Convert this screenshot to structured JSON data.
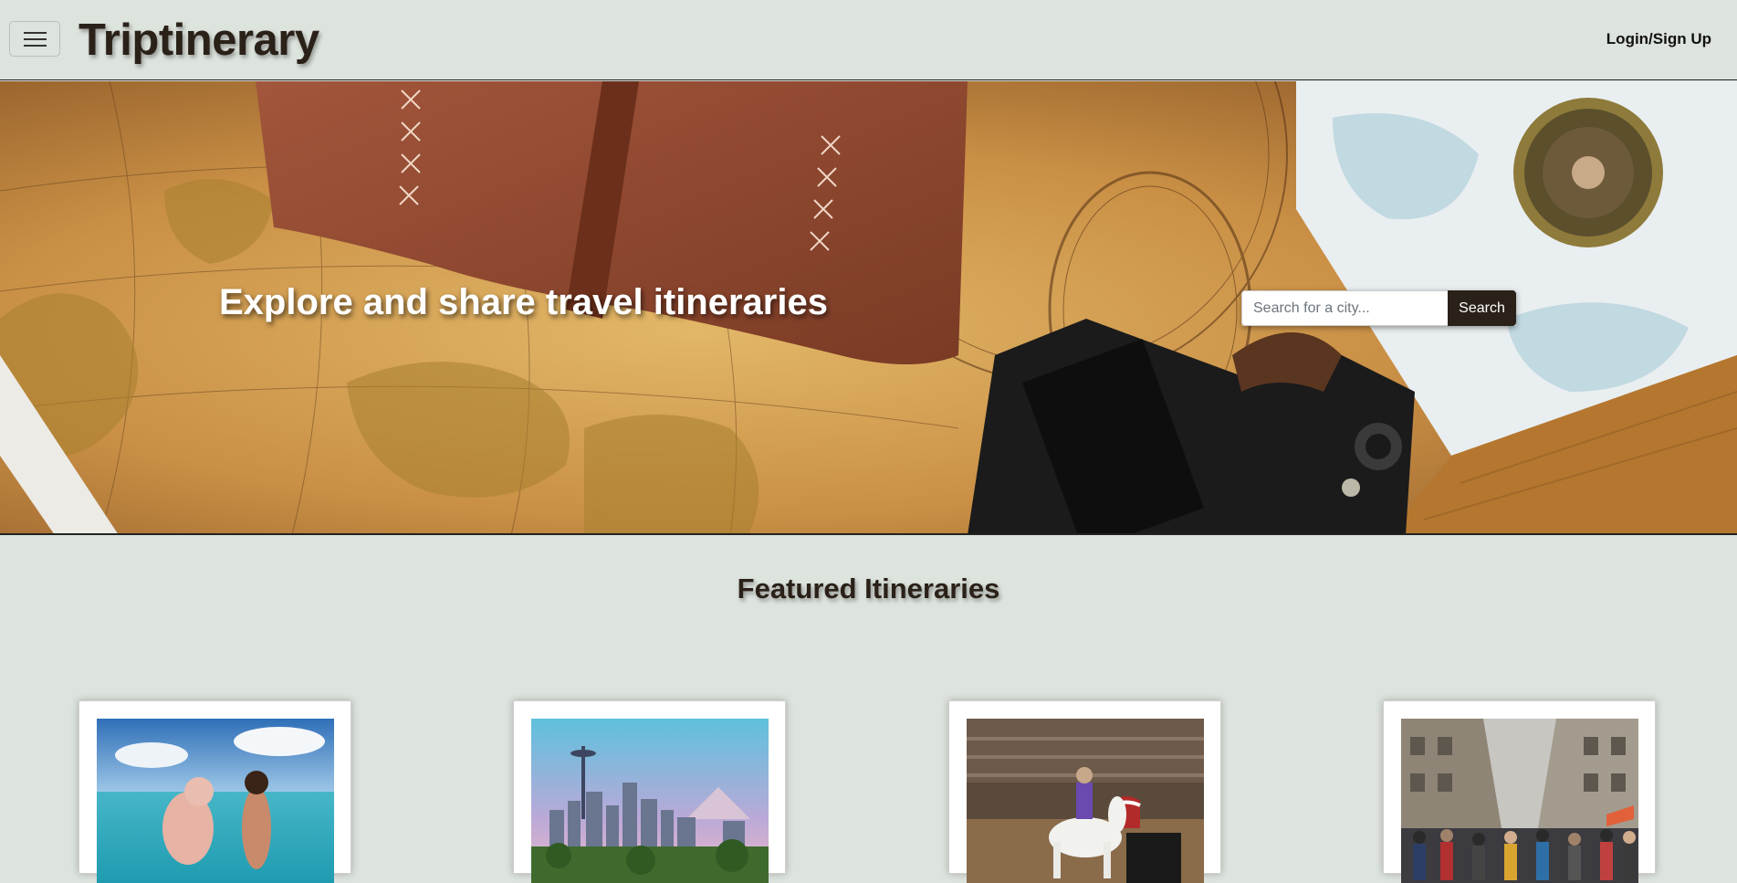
{
  "navbar": {
    "brand": "Triptinerary",
    "login_label": "Login/Sign Up",
    "menu_icon": "hamburger-menu-icon"
  },
  "hero": {
    "title": "Explore and share travel itineraries",
    "search_placeholder": "Search for a city...",
    "search_button_label": "Search",
    "background": "vintage world map, leather journal, camera and compass"
  },
  "featured": {
    "title": "Featured Itineraries",
    "cards": [
      {
        "image": "swimming pig with woman in turquoise sea"
      },
      {
        "image": "city skyline with needle tower and snowy mountain"
      },
      {
        "image": "rodeo rider on white horse in arena"
      },
      {
        "image": "crowded city street between tall buildings"
      }
    ]
  },
  "colors": {
    "page_background": "#dde3dd",
    "brand_text": "#2a2119",
    "search_button": "#2a2119"
  }
}
